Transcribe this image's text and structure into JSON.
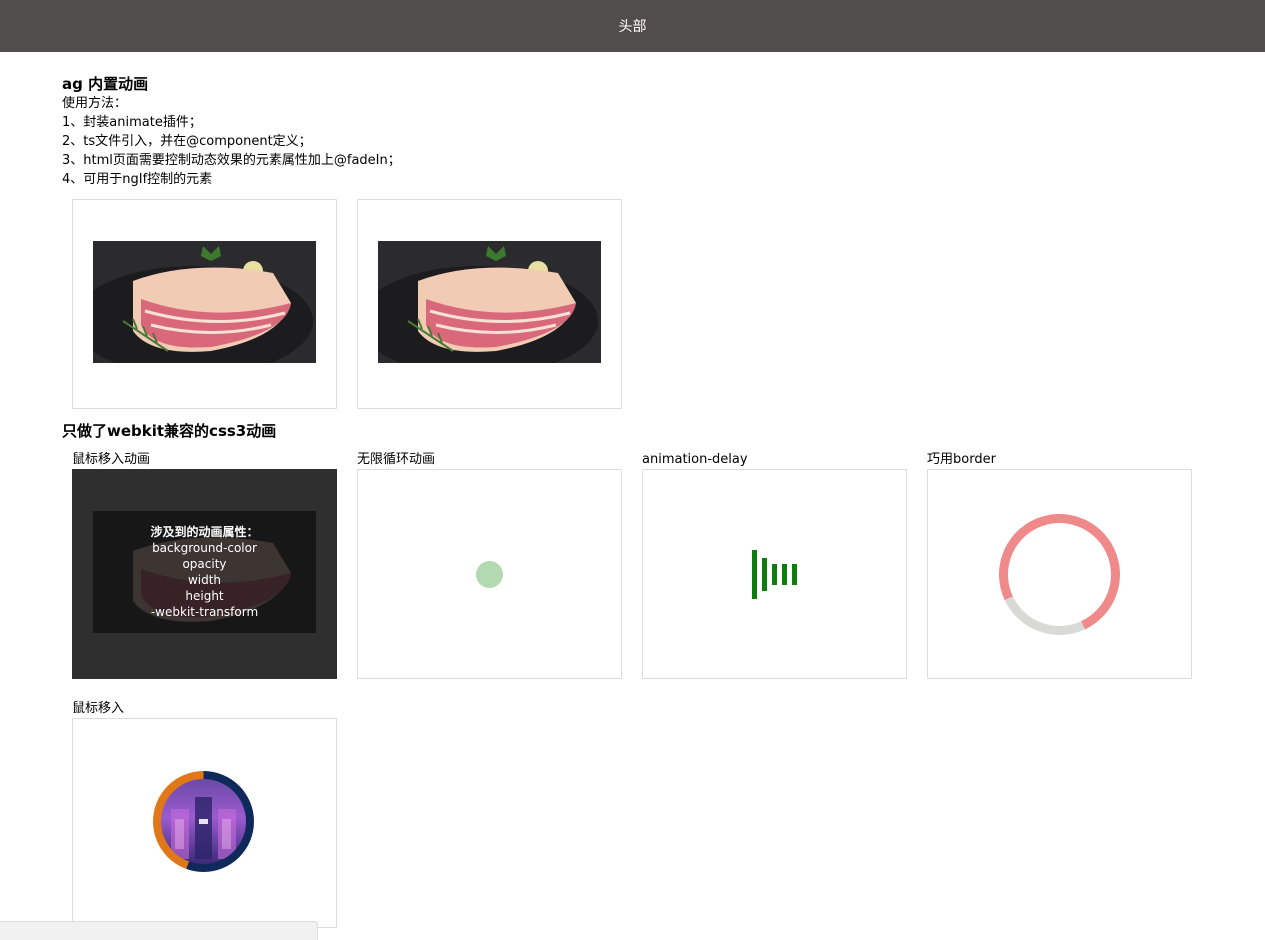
{
  "header": {
    "title": "头部"
  },
  "section1": {
    "title": "ag 内置动画",
    "lines": [
      "使用方法：",
      "1、封装animate插件；",
      "2、ts文件引入，并在@component定义；",
      "3、html页面需要控制动态效果的元素属性加上@fadeIn；",
      "4、可用于ngIf控制的元素"
    ]
  },
  "section2": {
    "title": "只做了webkit兼容的css3动画",
    "labels": {
      "hover": "鼠标移入动画",
      "loop": "无限循环动画",
      "delay": "animation-delay",
      "border": "巧用border",
      "hover2": "鼠标移入"
    },
    "hover_overlay": {
      "title": "涉及到的动画属性：",
      "items": [
        "background-color",
        "opacity",
        "width",
        "height",
        "-webkit-transform"
      ]
    }
  },
  "colors": {
    "header_bg": "#524d4d",
    "loop_dot": "#b3d9b0",
    "delay_bars": "#0d7d0d",
    "ring_main": "#f08a8a",
    "ring_rest": "#d9d9d6"
  },
  "icons": {
    "pork_image": "pork-photo",
    "avatar_image": "ios-animation-avatar"
  }
}
